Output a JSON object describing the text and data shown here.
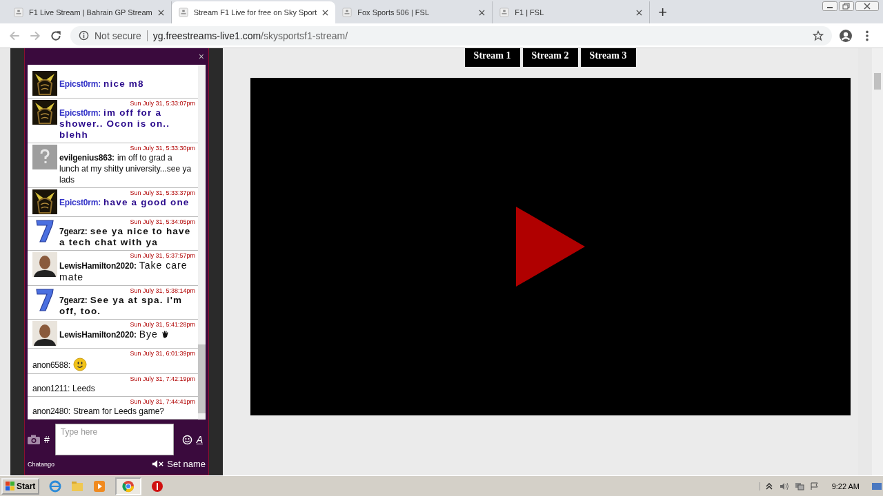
{
  "browser": {
    "tabs": [
      {
        "title": "F1 Live Stream | Bahrain GP Stream",
        "selected": false
      },
      {
        "title": "Stream F1 Live for free on Sky Sport",
        "selected": true
      },
      {
        "title": "Fox Sports 506 | FSL",
        "selected": false
      },
      {
        "title": "F1 | FSL",
        "selected": false
      }
    ],
    "new_tab": "+",
    "security": "Not secure",
    "url": {
      "host": "yg.freestreams-live1.com",
      "path": "/skysportsf1-stream/"
    }
  },
  "chat": {
    "close": "×",
    "messages": [
      {
        "kind": "bold",
        "avatar": {
          "kind": "warrior"
        },
        "name": "Epicst0rm:",
        "text": "nice m8",
        "color": "#2a0a8c"
      },
      {
        "kind": "bold",
        "avatar": {
          "kind": "warrior"
        },
        "time": "Sun July 31, 5:33:07pm",
        "name": "Epicst0rm:",
        "text": "im off for a shower.. Ocon is on.. blehh",
        "color": "#2a0a8c"
      },
      {
        "kind": "plain",
        "avatar": {
          "kind": "question"
        },
        "time": "Sun July 31, 5:33:30pm",
        "name": "evilgenius863:",
        "text": "im off to grad a lunch at my shitty university...see ya lads",
        "color": "#111111"
      },
      {
        "kind": "bold",
        "avatar": {
          "kind": "warrior"
        },
        "time": "Sun July 31, 5:33:37pm",
        "name": "Epicst0rm:",
        "text": "have a good one",
        "color": "#2a0a8c"
      },
      {
        "kind": "bold",
        "avatar": {
          "kind": "seven"
        },
        "time": "Sun July 31, 5:34:05pm",
        "name": "7gearz:",
        "text": "see ya nice to have a tech chat with ya",
        "color": "#111111"
      },
      {
        "kind": "large",
        "avatar": {
          "kind": "person"
        },
        "time": "Sun July 31, 5:37:57pm",
        "name": "LewisHamilton2020:",
        "text": "Take care mate",
        "color": "#111111"
      },
      {
        "kind": "bold",
        "avatar": {
          "kind": "seven"
        },
        "time": "Sun July 31, 5:38:14pm",
        "name": "7gearz:",
        "text": "See ya at spa. i'm off, too.",
        "color": "#111111"
      },
      {
        "kind": "large",
        "avatar": {
          "kind": "person"
        },
        "time": "Sun July 31, 5:41:28pm",
        "name": "LewisHamilton2020:",
        "text": "Bye",
        "color": "#111111",
        "emoji": {
          "kind": "hand"
        }
      },
      {
        "kind": "plain",
        "time": "Sun July 31, 6:01:39pm",
        "name": "anon6588:",
        "color": "#111111",
        "emoji": {
          "kind": "smiley"
        }
      },
      {
        "kind": "plain",
        "time": "Sun July 31, 7:42:19pm",
        "name": "anon1211:",
        "text": "Leeds",
        "color": "#111111"
      },
      {
        "kind": "plain",
        "time": "Sun July 31, 7:44:41pm",
        "name": "anon2480:",
        "text": "Stream for Leeds game?",
        "color": "#111111"
      }
    ],
    "hash": "#",
    "input": {
      "placeholder": "Type here"
    },
    "font_button": "A",
    "brand": "Chatango",
    "set_name": "Set name"
  },
  "streams": [
    {
      "label": "Stream 1"
    },
    {
      "label": "Stream 2"
    },
    {
      "label": "Stream 3"
    }
  ],
  "taskbar": {
    "start": "Start",
    "clock": "9:22 AM"
  }
}
